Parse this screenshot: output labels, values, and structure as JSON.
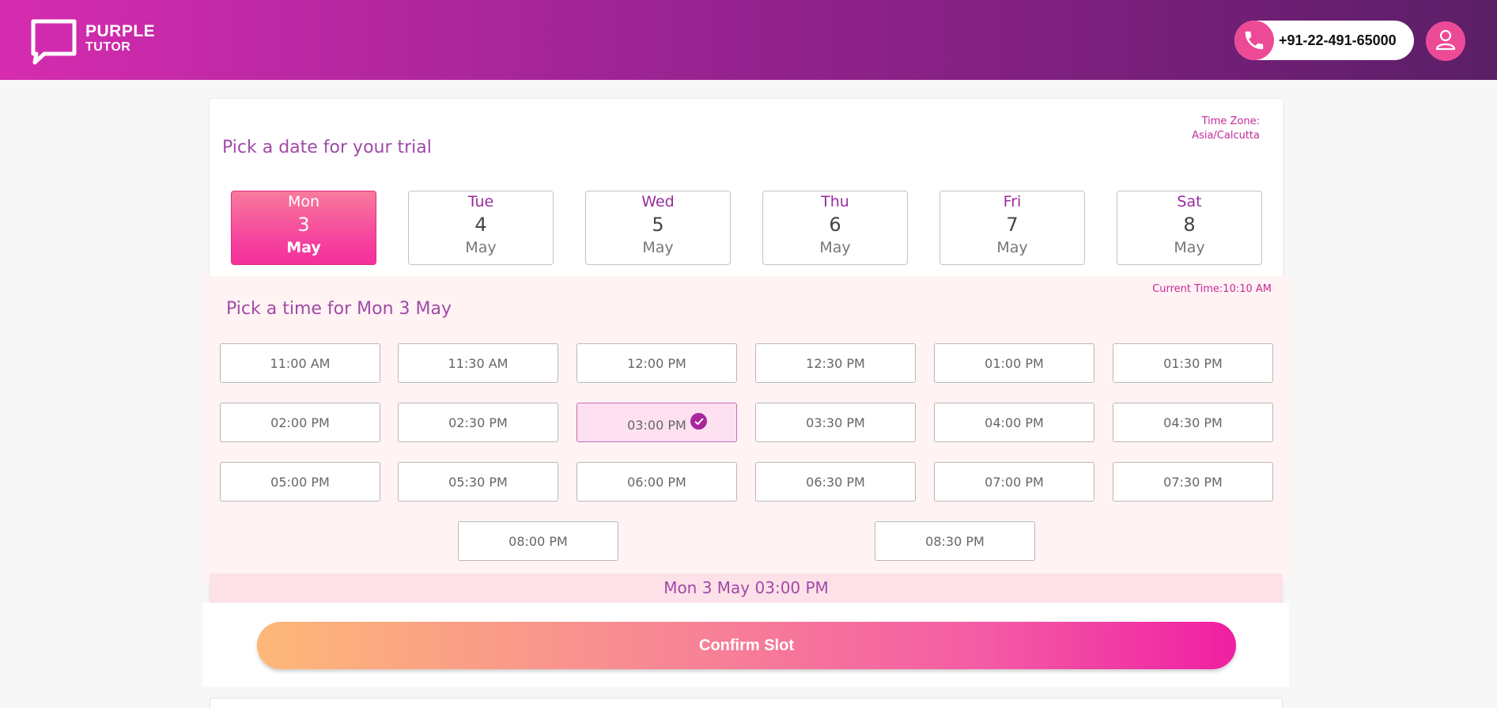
{
  "header": {
    "brand_line1": "PURPLE",
    "brand_line2": "TUTOR",
    "phone": "+91-22-491-65000"
  },
  "date_picker": {
    "title": "Pick a date for your trial",
    "timezone_label": "Time Zone:",
    "timezone_value": "Asia/Calcutta",
    "dates": [
      {
        "dow": "Mon",
        "day": "3",
        "month": "May",
        "selected": true
      },
      {
        "dow": "Tue",
        "day": "4",
        "month": "May",
        "selected": false
      },
      {
        "dow": "Wed",
        "day": "5",
        "month": "May",
        "selected": false
      },
      {
        "dow": "Thu",
        "day": "6",
        "month": "May",
        "selected": false
      },
      {
        "dow": "Fri",
        "day": "7",
        "month": "May",
        "selected": false
      },
      {
        "dow": "Sat",
        "day": "8",
        "month": "May",
        "selected": false
      }
    ]
  },
  "time_picker": {
    "title": "Pick a time for Mon 3 May",
    "current_time": "Current Time:10:10 AM",
    "slots": [
      "11:00 AM",
      "11:30 AM",
      "12:00 PM",
      "12:30 PM",
      "01:00 PM",
      "01:30 PM",
      "02:00 PM",
      "02:30 PM",
      "03:00 PM",
      "03:30 PM",
      "04:00 PM",
      "04:30 PM",
      "05:00 PM",
      "05:30 PM",
      "06:00 PM",
      "06:30 PM",
      "07:00 PM",
      "07:30 PM",
      "08:00 PM",
      "08:30 PM"
    ],
    "selected_slot": "03:00 PM"
  },
  "summary": "Mon 3 May 03:00 PM",
  "confirm_label": "Confirm Slot",
  "colors": {
    "accent_pink": "#f5309c",
    "accent_purple": "#a04aa8",
    "header_start": "#d62cb0",
    "header_end": "#5a1f66"
  }
}
